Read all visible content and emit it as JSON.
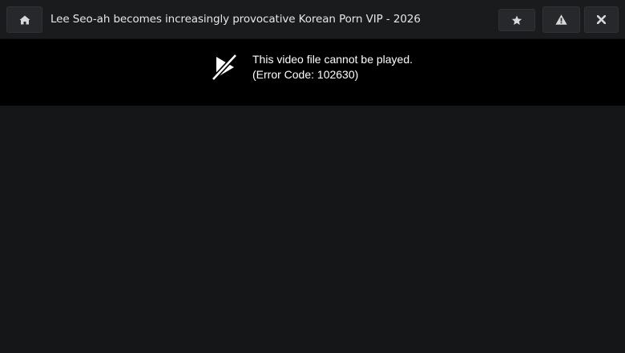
{
  "header": {
    "title": "Lee Seo-ah becomes increasingly provocative Korean Porn VIP - 2026",
    "buttons": {
      "home_icon": "home-icon",
      "favorite_icon": "star-icon",
      "report_icon": "warning-icon",
      "close_icon": "close-icon"
    }
  },
  "player": {
    "error_message": "This video file cannot be played.",
    "error_code": "(Error Code: 102630)",
    "error_icon": "video-slash-icon"
  },
  "colors": {
    "topbar_bg": "#1a1b1d",
    "button_bg": "#26282b",
    "player_bg": "#000000",
    "page_bg": "#151617",
    "text": "#ffffff"
  }
}
